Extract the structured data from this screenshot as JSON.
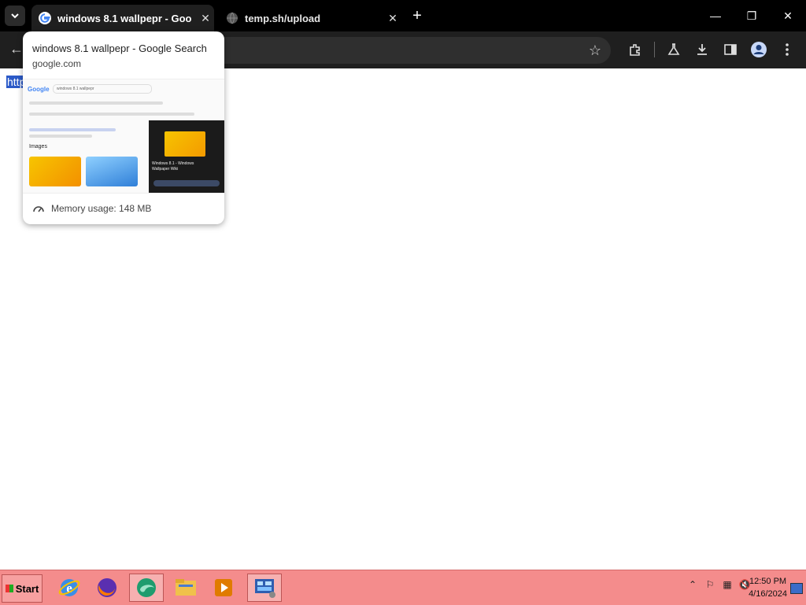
{
  "browser": {
    "tabs": [
      {
        "title": "windows 8.1 wallpepr - Goo",
        "active": true
      },
      {
        "title": "temp.sh/upload",
        "active": false
      }
    ],
    "new_tab_label": "+"
  },
  "page": {
    "selected_text": "http"
  },
  "hovercard": {
    "title": "windows 8.1 wallpepr - Google Search",
    "domain": "google.com",
    "memory": "Memory usage: 148 MB",
    "preview": {
      "search_query": "windows 8.1 wallpepr",
      "images_label": "Images",
      "result_title": "Windows 8.1 - Windows Wallpaper Wiki"
    }
  },
  "taskbar": {
    "start_label": "Start",
    "time": "12:50 PM",
    "date": "4/16/2024"
  }
}
